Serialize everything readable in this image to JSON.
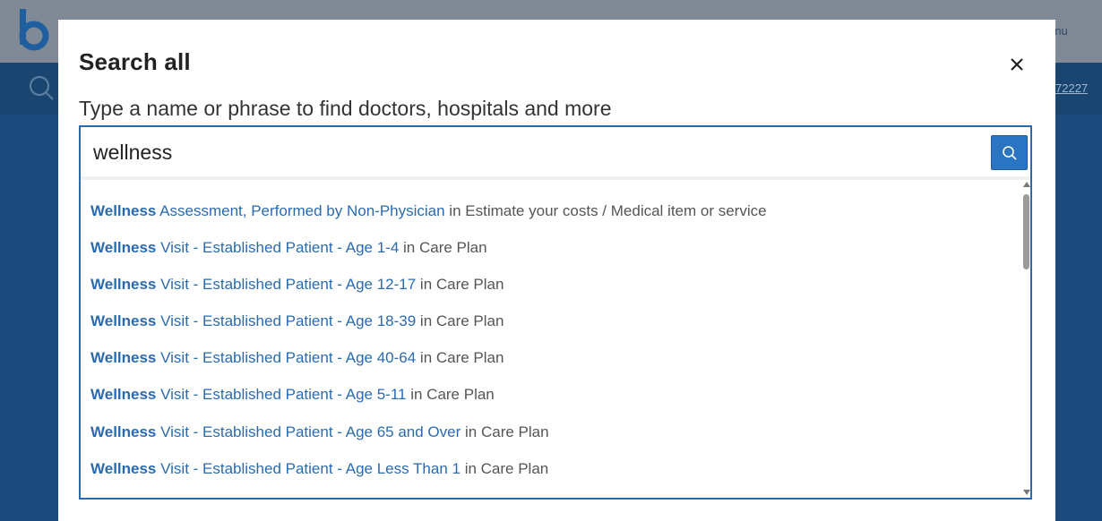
{
  "background": {
    "menu_label": "enu",
    "phone_link": "72227"
  },
  "modal": {
    "title": "Search all",
    "subtitle": "Type a name or phrase to find doctors, hospitals and more",
    "search_value": "wellness",
    "results": [
      {
        "match": "Wellness",
        "rest": " Assessment, Performed by Non-Physician",
        "context": " in Estimate your costs / Medical item or service"
      },
      {
        "match": "Wellness",
        "rest": " Visit - Established Patient - Age 1-4",
        "context": " in Care Plan"
      },
      {
        "match": "Wellness",
        "rest": " Visit - Established Patient - Age 12-17",
        "context": " in Care Plan"
      },
      {
        "match": "Wellness",
        "rest": " Visit - Established Patient - Age 18-39",
        "context": " in Care Plan"
      },
      {
        "match": "Wellness",
        "rest": " Visit - Established Patient - Age 40-64",
        "context": " in Care Plan"
      },
      {
        "match": "Wellness",
        "rest": " Visit - Established Patient - Age 5-11",
        "context": " in Care Plan"
      },
      {
        "match": "Wellness",
        "rest": " Visit - Established Patient - Age 65 and Over",
        "context": " in Care Plan"
      },
      {
        "match": "Wellness",
        "rest": " Visit - Established Patient - Age Less Than 1",
        "context": " in Care Plan"
      }
    ]
  },
  "icons": {
    "close": "close-icon",
    "search": "search-icon",
    "logo": "logo-icon"
  },
  "colors": {
    "link": "#2a6bb0",
    "accent": "#2a74c2",
    "backdrop": "#1c4a7c"
  }
}
